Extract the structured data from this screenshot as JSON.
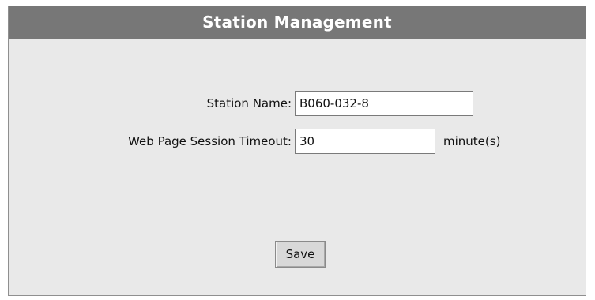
{
  "panel": {
    "title": "Station Management"
  },
  "form": {
    "station_name": {
      "label": "Station Name:",
      "value": "B060-032-8"
    },
    "session_timeout": {
      "label": "Web Page Session Timeout:",
      "value": "30",
      "unit": "minute(s)"
    },
    "save_label": "Save"
  },
  "colors": {
    "header_background": "#777777",
    "panel_background": "#e9e9e9",
    "header_text": "#ffffff"
  }
}
